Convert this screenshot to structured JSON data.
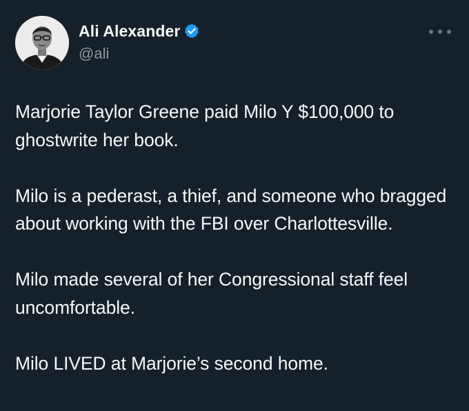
{
  "author": {
    "display_name": "Ali Alexander",
    "handle": "@ali",
    "verified": true,
    "verified_color": "#1d9bf0"
  },
  "more_icon": "ellipsis-icon",
  "tweet": {
    "paragraphs": [
      "Marjorie Taylor Greene paid Milo Y $100,000 to ghostwrite her book.",
      "Milo is a pederast, a thief, and someone who bragged about working with the FBI over Charlottesville.",
      "Milo made several of her Congressional staff feel uncomfortable.",
      "Milo LIVED at Marjorie’s second home."
    ]
  },
  "colors": {
    "background": "#15202b",
    "text": "#f7f9f9",
    "secondary_text": "#8b98a5"
  }
}
